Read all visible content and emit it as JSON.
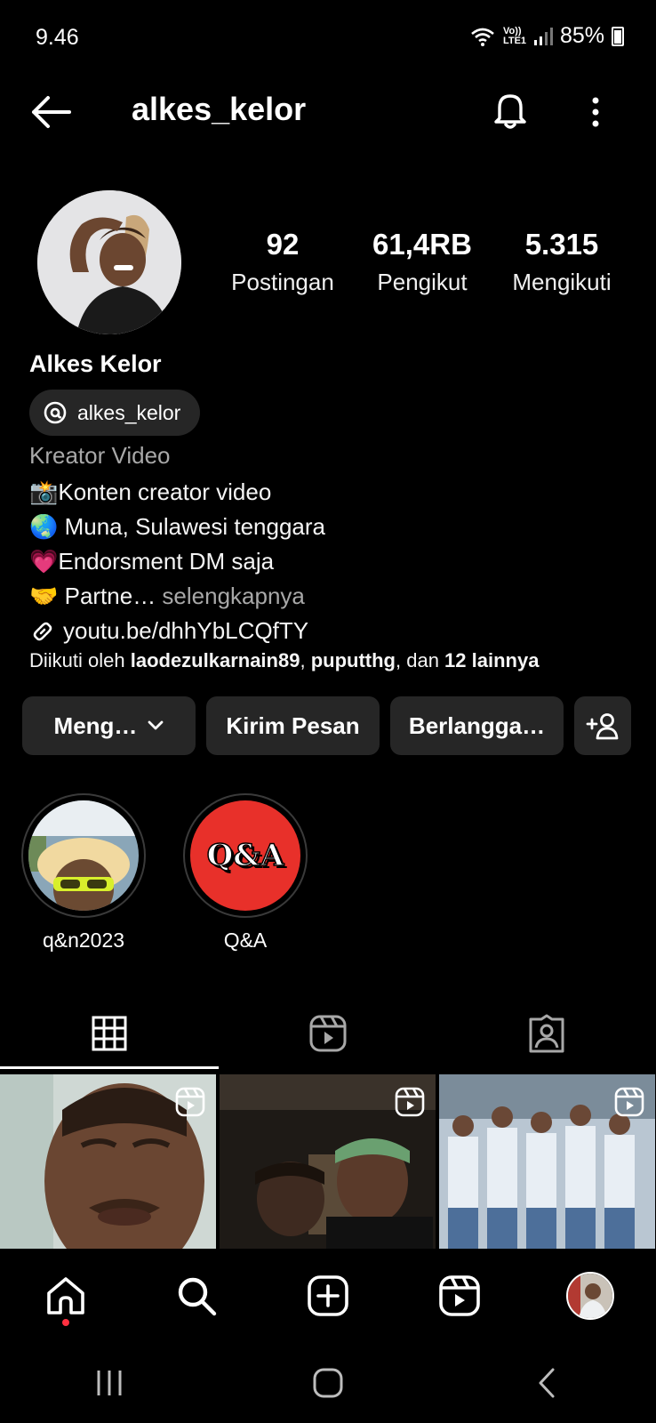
{
  "status_bar": {
    "time": "9.46",
    "network": "Vo)) LTE1",
    "battery": "85%"
  },
  "header": {
    "username": "alkes_kelor"
  },
  "profile": {
    "stats": [
      {
        "value": "92",
        "label": "Postingan"
      },
      {
        "value": "61,4RB",
        "label": "Pengikut"
      },
      {
        "value": "5.315",
        "label": "Mengikuti"
      }
    ],
    "display_name": "Alkes Kelor",
    "threads_handle": "alkes_kelor",
    "category": "Kreator Video",
    "bio": {
      "line1": "📸Konten creator video",
      "line2": "🌏 Muna, Sulawesi tenggara",
      "line3": "💗Endorsment DM saja",
      "line4_prefix": "🤝 Partne…",
      "more": " selengkapnya",
      "link": "youtu.be/dhhYbLCQfTY"
    },
    "followed_by": {
      "prefix": "Diikuti oleh ",
      "user1": "laodezulkarnain89",
      "sep": ", ",
      "user2": "puputthg",
      "mid": ", dan ",
      "count": "12 lainnya"
    }
  },
  "actions": {
    "follow": "Meng…",
    "message": "Kirim Pesan",
    "subscribe": "Berlangga…"
  },
  "highlights": [
    {
      "label": "q&n2023"
    },
    {
      "label": "Q&A",
      "cover_text": "Q&A"
    }
  ],
  "tabs": [
    {
      "icon": "grid-icon",
      "active": true
    },
    {
      "icon": "reels-icon",
      "active": false
    },
    {
      "icon": "tagged-icon",
      "active": false
    }
  ],
  "colors": {
    "background": "#000000",
    "button": "#262626",
    "muted_text": "#a8a8a8",
    "notification_dot": "#ff3040",
    "qa_red": "#e8302a"
  }
}
